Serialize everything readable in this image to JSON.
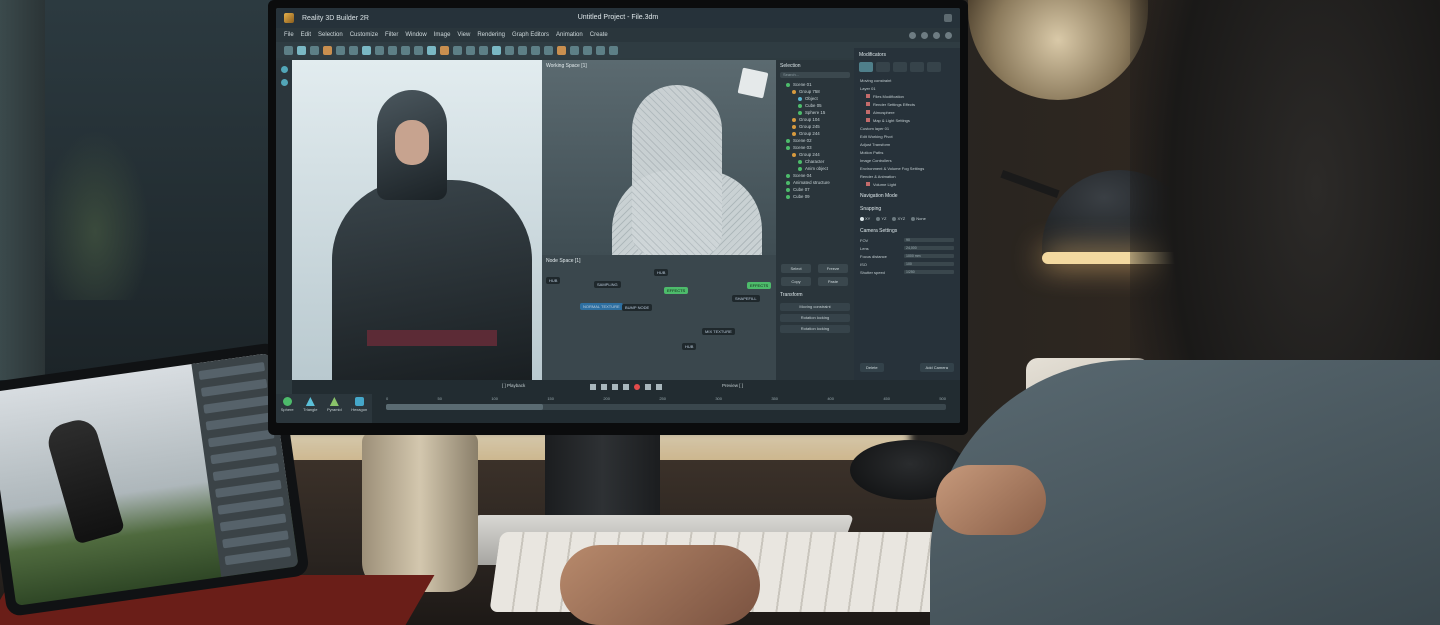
{
  "app": {
    "name": "Reality 3D Builder 2R",
    "document_title": "Untitled Project - File.3dm"
  },
  "menu": [
    "File",
    "Edit",
    "Selection",
    "Customize",
    "Filter",
    "Window",
    "Image",
    "View",
    "Rendering",
    "Graph Editors",
    "Animation",
    "Create"
  ],
  "panes": {
    "working_space": "Working Space [1]",
    "node_space": "Node Space [1]"
  },
  "outliner": {
    "title": "Selection",
    "search_placeholder": "Search...",
    "items": [
      {
        "label": "Scene 01",
        "level": 1,
        "color": "green"
      },
      {
        "label": "Group 758",
        "level": 2,
        "color": "orange"
      },
      {
        "label": "Object",
        "level": 3,
        "color": "blue"
      },
      {
        "label": "Cube 05",
        "level": 3,
        "color": "green"
      },
      {
        "label": "Sphere 15",
        "level": 3,
        "color": "green"
      },
      {
        "label": "Group 104",
        "level": 2,
        "color": "orange"
      },
      {
        "label": "Group 245",
        "level": 2,
        "color": "orange"
      },
      {
        "label": "Group 244",
        "level": 2,
        "color": "orange"
      },
      {
        "label": "Scene 02",
        "level": 1,
        "color": "green"
      },
      {
        "label": "Scene 03",
        "level": 1,
        "color": "green"
      },
      {
        "label": "Group 244",
        "level": 2,
        "color": "orange"
      },
      {
        "label": "Character",
        "level": 3,
        "color": "green"
      },
      {
        "label": "Anim object",
        "level": 3,
        "color": "green"
      },
      {
        "label": "Scene 04",
        "level": 1,
        "color": "green"
      },
      {
        "label": "Animated structure",
        "level": 1,
        "color": "green"
      },
      {
        "label": "Cube 07",
        "level": 1,
        "color": "green"
      },
      {
        "label": "Cube 09",
        "level": 1,
        "color": "green"
      }
    ]
  },
  "operations": {
    "buttons": [
      "Select",
      "Freeze",
      "Copy",
      "Paste"
    ],
    "transform_title": "Transform",
    "transform_rows": [
      "Moving constraint",
      "Rotation locking",
      "Rotation locking"
    ]
  },
  "modifiers": {
    "title": "Modificators",
    "header_row": "Moving constraint",
    "rows": [
      {
        "label": "Layer 01",
        "sub": false
      },
      {
        "label": "Files Modification",
        "sub": true
      },
      {
        "label": "Render Settings Effects",
        "sub": true
      },
      {
        "label": "Atmosphere",
        "sub": true
      },
      {
        "label": "Map & Light Settings",
        "sub": true
      },
      {
        "label": "Custom layer 01",
        "sub": false
      },
      {
        "label": "Edit Working Pivot",
        "sub": false
      },
      {
        "label": "Adjust Transform",
        "sub": false
      },
      {
        "label": "Motion Paths",
        "sub": false
      },
      {
        "label": "Image Controllers",
        "sub": false
      },
      {
        "label": "Environment & Volume Fog Settings",
        "sub": false
      },
      {
        "label": "Render & Animation",
        "sub": false
      },
      {
        "label": "Volume Light",
        "sub": true
      }
    ],
    "navigation_mode": "Navigation Mode",
    "snapping": {
      "title": "Snapping",
      "options": [
        "XY",
        "YZ",
        "XYZ",
        "None"
      ],
      "selected": "XY"
    },
    "camera": {
      "title": "Camera Settings",
      "fields": [
        {
          "label": "FOV",
          "value": "90"
        },
        {
          "label": "Lens",
          "value": "24,000"
        },
        {
          "label": "Focus distance",
          "value": "1000 mm"
        },
        {
          "label": "ISO",
          "value": "100"
        },
        {
          "label": "Shutter speed",
          "value": "1/250"
        }
      ]
    },
    "actions": [
      "Delete",
      "Add Camera"
    ]
  },
  "playback": {
    "label": "[ ] Playback",
    "preview": "Preview [ ]"
  },
  "timeline": {
    "ticks": [
      "0",
      "50",
      "100",
      "150",
      "200",
      "250",
      "300",
      "350",
      "400",
      "450",
      "500"
    ],
    "progress": 0.28
  },
  "primitives": [
    "Sphere",
    "Triangle",
    "Pyramid",
    "Hexagon"
  ],
  "nodes": [
    {
      "label": "HUB",
      "color": "dark"
    },
    {
      "label": "SAMPLING",
      "color": "dark"
    },
    {
      "label": "HUB",
      "color": "dark"
    },
    {
      "label": "EFFECTS",
      "color": "green"
    },
    {
      "label": "NORMAL TEXTURE",
      "color": "blue"
    },
    {
      "label": "BUMP NODE",
      "color": "dark"
    },
    {
      "label": "SHAPEFILL",
      "color": "dark"
    },
    {
      "label": "MIX TEXTURE",
      "color": "dark"
    },
    {
      "label": "HUB",
      "color": "dark"
    },
    {
      "label": "EFFECTS",
      "color": "green"
    }
  ]
}
